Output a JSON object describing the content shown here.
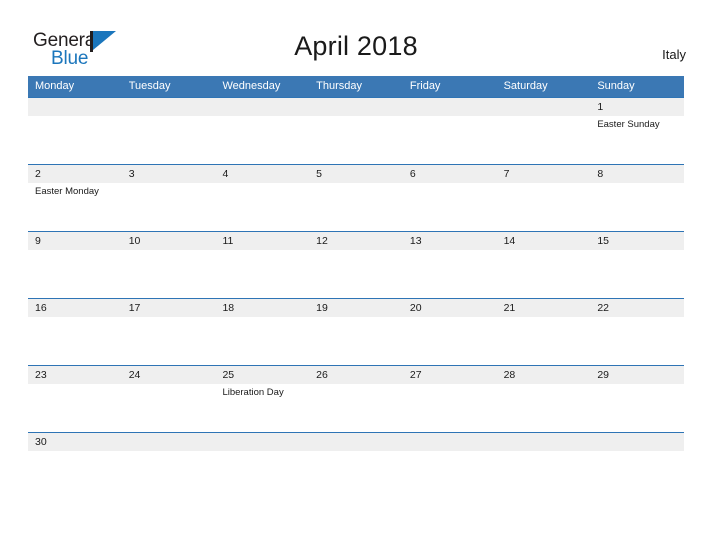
{
  "brand": {
    "name_part1": "General",
    "name_part2": "Blue",
    "flag_icon": "flag-icon"
  },
  "header": {
    "title": "April 2018",
    "country": "Italy"
  },
  "calendar": {
    "weekdays": [
      "Monday",
      "Tuesday",
      "Wednesday",
      "Thursday",
      "Friday",
      "Saturday",
      "Sunday"
    ],
    "colors": {
      "header_blue": "#3b78b4",
      "row_line_blue": "#2e74b5",
      "number_band_gray": "#efefef",
      "brand_blue": "#1b76bc",
      "text_dark": "#1a1a1a"
    },
    "weeks": [
      {
        "days": [
          {
            "num": "",
            "event": ""
          },
          {
            "num": "",
            "event": ""
          },
          {
            "num": "",
            "event": ""
          },
          {
            "num": "",
            "event": ""
          },
          {
            "num": "",
            "event": ""
          },
          {
            "num": "",
            "event": ""
          },
          {
            "num": "1",
            "event": "Easter Sunday"
          }
        ]
      },
      {
        "days": [
          {
            "num": "2",
            "event": "Easter Monday"
          },
          {
            "num": "3",
            "event": ""
          },
          {
            "num": "4",
            "event": ""
          },
          {
            "num": "5",
            "event": ""
          },
          {
            "num": "6",
            "event": ""
          },
          {
            "num": "7",
            "event": ""
          },
          {
            "num": "8",
            "event": ""
          }
        ]
      },
      {
        "days": [
          {
            "num": "9",
            "event": ""
          },
          {
            "num": "10",
            "event": ""
          },
          {
            "num": "11",
            "event": ""
          },
          {
            "num": "12",
            "event": ""
          },
          {
            "num": "13",
            "event": ""
          },
          {
            "num": "14",
            "event": ""
          },
          {
            "num": "15",
            "event": ""
          }
        ]
      },
      {
        "days": [
          {
            "num": "16",
            "event": ""
          },
          {
            "num": "17",
            "event": ""
          },
          {
            "num": "18",
            "event": ""
          },
          {
            "num": "19",
            "event": ""
          },
          {
            "num": "20",
            "event": ""
          },
          {
            "num": "21",
            "event": ""
          },
          {
            "num": "22",
            "event": ""
          }
        ]
      },
      {
        "days": [
          {
            "num": "23",
            "event": ""
          },
          {
            "num": "24",
            "event": ""
          },
          {
            "num": "25",
            "event": "Liberation Day"
          },
          {
            "num": "26",
            "event": ""
          },
          {
            "num": "27",
            "event": ""
          },
          {
            "num": "28",
            "event": ""
          },
          {
            "num": "29",
            "event": ""
          }
        ]
      },
      {
        "days": [
          {
            "num": "30",
            "event": ""
          },
          {
            "num": "",
            "event": ""
          },
          {
            "num": "",
            "event": ""
          },
          {
            "num": "",
            "event": ""
          },
          {
            "num": "",
            "event": ""
          },
          {
            "num": "",
            "event": ""
          },
          {
            "num": "",
            "event": ""
          }
        ]
      }
    ]
  }
}
